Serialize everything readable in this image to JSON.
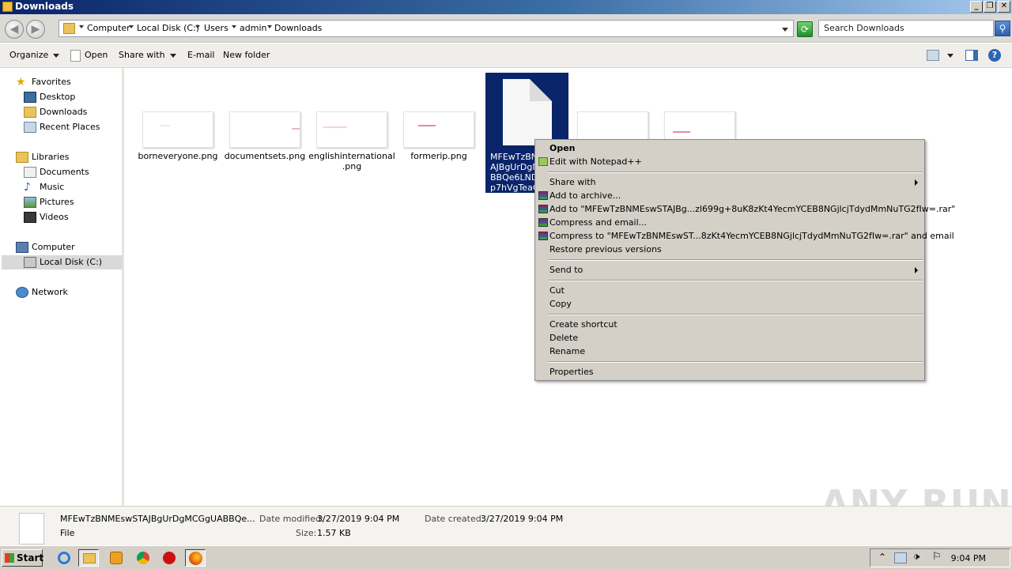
{
  "window": {
    "title": "Downloads"
  },
  "address": {
    "crumbs": [
      "Computer",
      "Local Disk (C:)",
      "Users",
      "admin",
      "Downloads"
    ],
    "search_placeholder": "Search Downloads"
  },
  "toolbar": {
    "organize": "Organize",
    "open": "Open",
    "share_with": "Share with",
    "email": "E-mail",
    "new_folder": "New folder"
  },
  "nav": {
    "favorites": "Favorites",
    "desktop": "Desktop",
    "downloads": "Downloads",
    "recent_places": "Recent Places",
    "libraries": "Libraries",
    "documents": "Documents",
    "music": "Music",
    "pictures": "Pictures",
    "videos": "Videos",
    "computer": "Computer",
    "local_disk": "Local Disk (C:)",
    "network": "Network"
  },
  "files": [
    {
      "name": "borneveryone.png"
    },
    {
      "name": "documentsets.png"
    },
    {
      "name_line1": "englishinternational",
      "name_line2": ".png"
    },
    {
      "name": "formerip.png"
    }
  ],
  "selected_file": {
    "lines": [
      "MFEwTzBNME",
      "AJBgUrDgM",
      "BBQe6LNDJ",
      "p7hVgTeaG"
    ]
  },
  "context_menu": {
    "open": "Open",
    "edit_notepad": "Edit with Notepad++",
    "share_with": "Share with",
    "add_archive": "Add to archive...",
    "add_to_rar": "Add to \"MFEwTzBNMEswSTAJBg...zl699g+8uK8zKt4YecmYCEB8NGjlcjTdydMmNuTG2fIw=.rar\"",
    "compress_email": "Compress and email...",
    "compress_to_rar_email": "Compress to \"MFEwTzBNMEswST...8zKt4YecmYCEB8NGjlcjTdydMmNuTG2fIw=.rar\" and email",
    "restore": "Restore previous versions",
    "send_to": "Send to",
    "cut": "Cut",
    "copy": "Copy",
    "create_shortcut": "Create shortcut",
    "delete": "Delete",
    "rename": "Rename",
    "properties": "Properties"
  },
  "details": {
    "filename": "MFEwTzBNMEswSTAJBgUrDgMCGgUABBQe...",
    "type": "File",
    "date_modified_label": "Date modified:",
    "date_modified": "3/27/2019 9:04 PM",
    "size_label": "Size:",
    "size": "1.57 KB",
    "date_created_label": "Date created:",
    "date_created": "3/27/2019 9:04 PM"
  },
  "taskbar": {
    "start": "Start",
    "clock": "9:04 PM"
  },
  "watermark": "ANY RUN"
}
